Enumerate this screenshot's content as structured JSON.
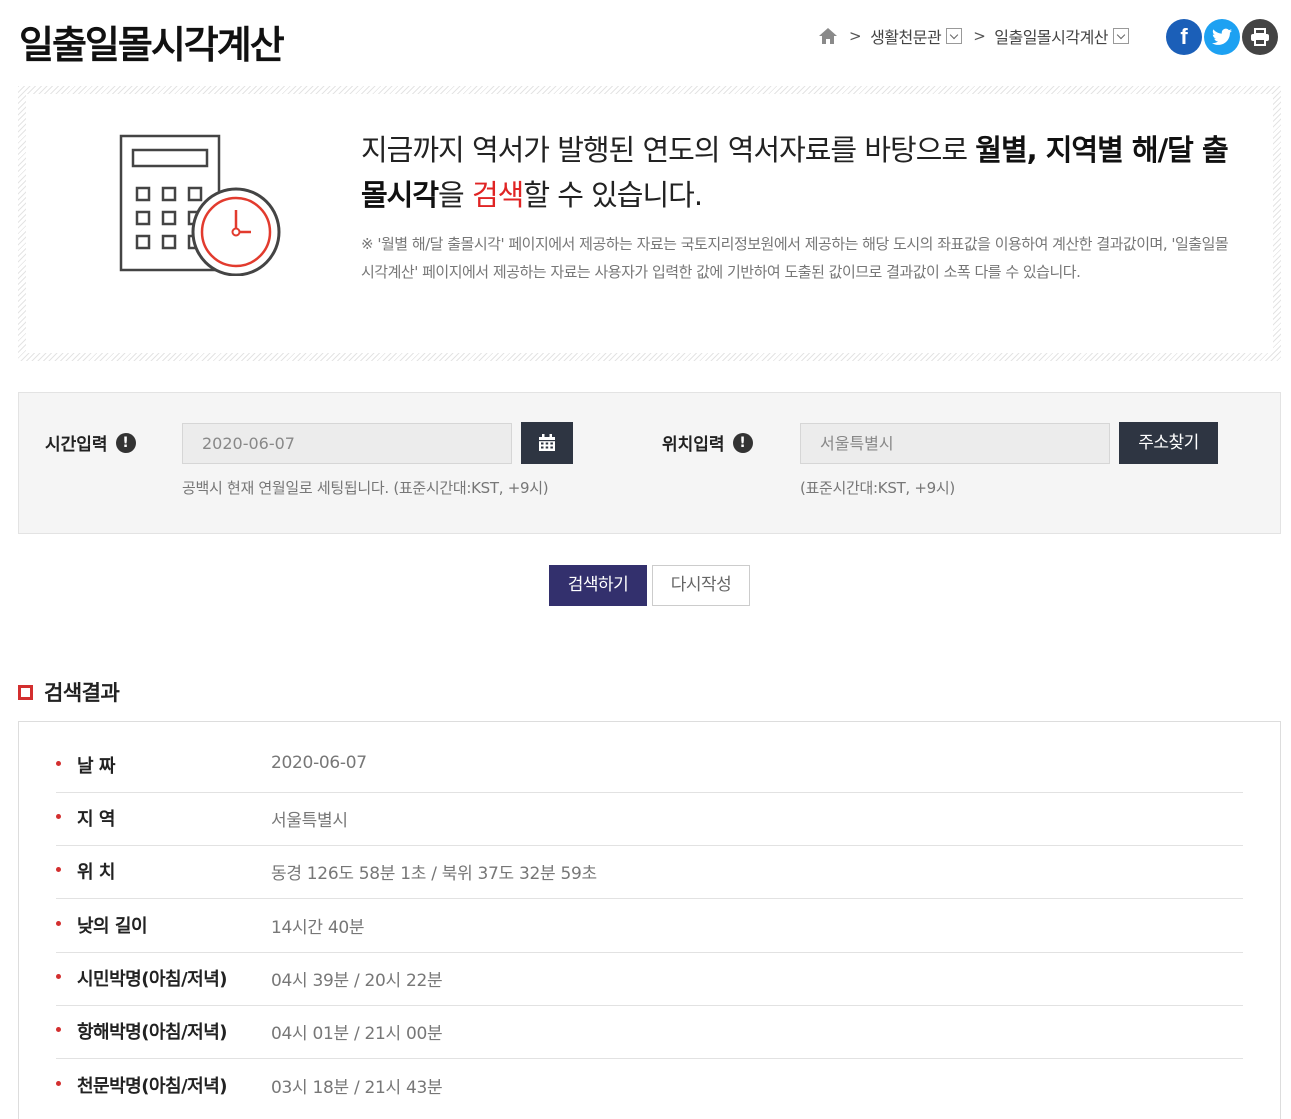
{
  "page": {
    "title": "일출일몰시각계산"
  },
  "breadcrumb": {
    "items": [
      "생활천문관",
      "일출일몰시각계산"
    ],
    "separator": ">"
  },
  "social": {
    "facebook": "f",
    "twitter": "t"
  },
  "intro": {
    "head_part1": "지금까지 역서가 발행된 연도의 역서자료를 바탕으로 ",
    "head_bold1": "월별, 지역별 해/달 출몰시각",
    "head_part2": "을 ",
    "head_red": "검색",
    "head_part3": "할 수 있습니다.",
    "note": "※ '월별 해/달 출몰시각' 페이지에서 제공하는 자료는 국토지리정보원에서 제공하는 해당 도시의 좌표값을 이용하여 계산한 결과값이며, '일출일몰시각계산' 페이지에서 제공하는 자료는 사용자가 입력한 값에 기반하여 도출된 값이므로 결과값이 소폭 다를 수 있습니다."
  },
  "form": {
    "time_label": "시간입력",
    "time_value": "2020-06-07",
    "time_help": "공백시 현재 연월일로 세팅됩니다. (표준시간대:KST, +9시)",
    "location_label": "위치입력",
    "location_value": "서울특별시",
    "location_help": "(표준시간대:KST, +9시)",
    "address_button": "주소찾기",
    "warn_glyph": "!"
  },
  "actions": {
    "search": "검색하기",
    "reset": "다시작성"
  },
  "results": {
    "title": "검색결과",
    "rows": [
      {
        "label": "날 짜",
        "value": "2020-06-07"
      },
      {
        "label": "지 역",
        "value": "서울특별시"
      },
      {
        "label": "위 치",
        "value": "동경 126도 58분 1초 / 북위 37도 32분 59초"
      },
      {
        "label": "낮의 길이",
        "value": "14시간 40분"
      },
      {
        "label": "시민박명(아침/저녁)",
        "value": "04시 39분 / 20시 22분"
      },
      {
        "label": "항해박명(아침/저녁)",
        "value": "04시 01분 / 21시 00분"
      },
      {
        "label": "천문박명(아침/저녁)",
        "value": "03시 18분 / 21시 43분"
      }
    ]
  },
  "colors": {
    "accent_red": "#d32f2f",
    "dark_button": "#2e3542",
    "search_button": "#33306d"
  }
}
